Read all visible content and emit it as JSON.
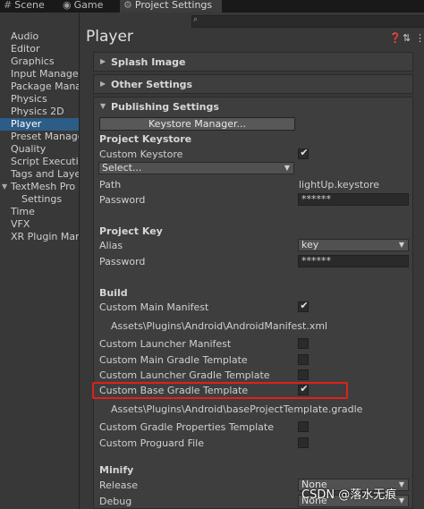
{
  "tabs": [
    {
      "label": "Scene",
      "icon": "hash-icon"
    },
    {
      "label": "Game",
      "icon": "gamepad-icon"
    },
    {
      "label": "Project Settings",
      "icon": "gear-icon"
    }
  ],
  "sidebar": {
    "items": [
      {
        "label": "Audio"
      },
      {
        "label": "Editor"
      },
      {
        "label": "Graphics"
      },
      {
        "label": "Input Manager"
      },
      {
        "label": "Package Mana"
      },
      {
        "label": "Physics"
      },
      {
        "label": "Physics 2D"
      },
      {
        "label": "Player",
        "selected": true
      },
      {
        "label": "Preset Manage"
      },
      {
        "label": "Quality"
      },
      {
        "label": "Script Executio"
      },
      {
        "label": "Tags and Laye"
      },
      {
        "label": "TextMesh Pro"
      },
      {
        "label": "Settings"
      },
      {
        "label": "Time"
      },
      {
        "label": "VFX"
      },
      {
        "label": "XR Plugin Mana"
      }
    ]
  },
  "header": {
    "title": "Player",
    "icons": [
      "help-icon",
      "presets-icon",
      "more-icon"
    ],
    "search_value": ""
  },
  "sections": {
    "splash": "Splash Image",
    "other": "Other Settings",
    "publishing": "Publishing Settings"
  },
  "publishing": {
    "keystore_manager_button": "Keystore Manager...",
    "project_keystore": {
      "heading": "Project Keystore",
      "custom_keystore_label": "Custom Keystore",
      "custom_keystore_checked": true,
      "select_value": "Select...",
      "path_label": "Path",
      "path_value": "lightUp.keystore",
      "password_label": "Password",
      "password_value": "******"
    },
    "project_key": {
      "heading": "Project Key",
      "alias_label": "Alias",
      "alias_value": "key",
      "password_label": "Password",
      "password_value": "******"
    },
    "build": {
      "heading": "Build",
      "custom_main_manifest": {
        "label": "Custom Main Manifest",
        "checked": true
      },
      "manifest_path": "Assets\\Plugins\\Android\\AndroidManifest.xml",
      "custom_launcher_manifest": {
        "label": "Custom Launcher Manifest",
        "checked": false
      },
      "custom_main_gradle": {
        "label": "Custom Main Gradle Template",
        "checked": false
      },
      "custom_launcher_gradle": {
        "label": "Custom Launcher Gradle Template",
        "checked": false
      },
      "custom_base_gradle": {
        "label": "Custom Base Gradle Template",
        "checked": true
      },
      "base_gradle_path": "Assets\\Plugins\\Android\\baseProjectTemplate.gradle",
      "custom_gradle_properties": {
        "label": "Custom Gradle Properties Template",
        "checked": false
      },
      "custom_proguard": {
        "label": "Custom Proguard File",
        "checked": false
      }
    },
    "minify": {
      "heading": "Minify",
      "release_label": "Release",
      "release_value": "None",
      "debug_label": "Debug",
      "debug_value": "None"
    }
  },
  "watermark": "CSDN @落水无痕",
  "colors": {
    "highlight": "#e0201b",
    "selected": "#2c5d87",
    "background": "#383838"
  }
}
